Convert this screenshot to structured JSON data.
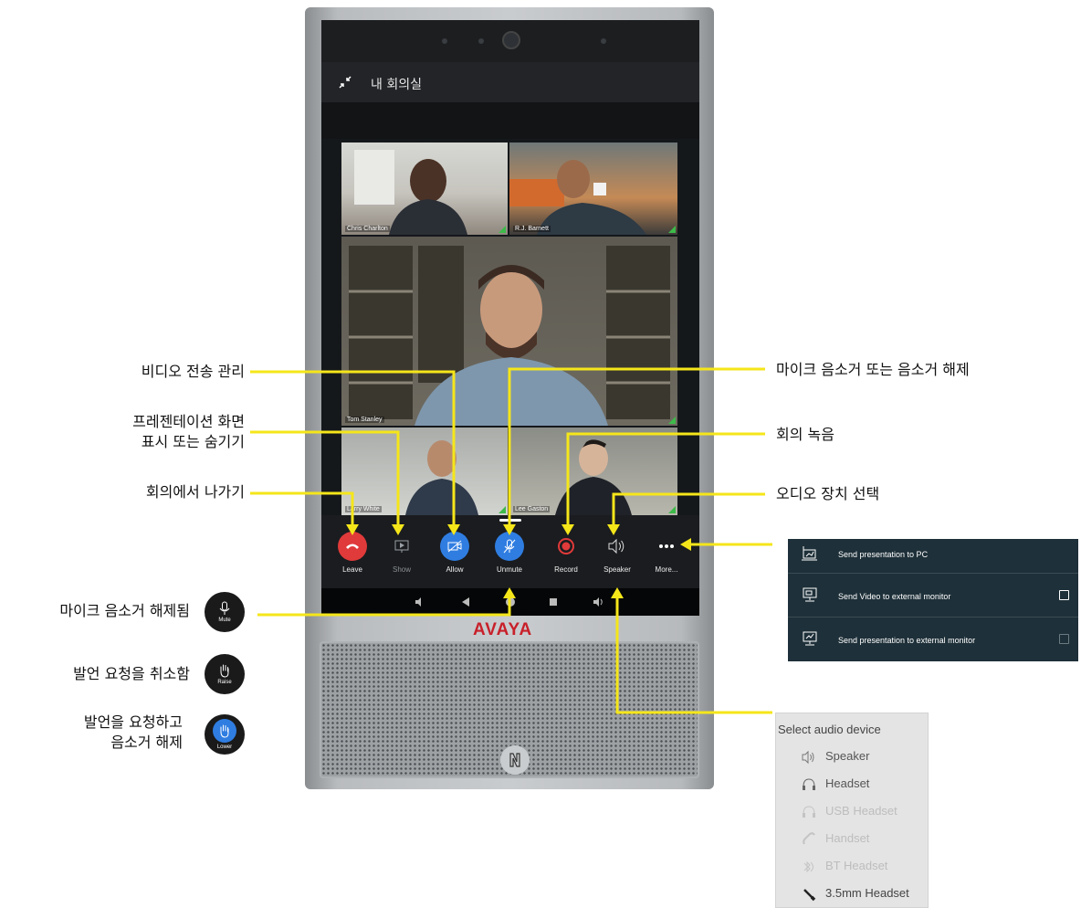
{
  "window": {
    "title": "내 회의실"
  },
  "participants": [
    {
      "name": "Chris Charlton"
    },
    {
      "name": "R.J. Barnett"
    },
    {
      "name": "Tom Stanley"
    },
    {
      "name": "Larry White"
    },
    {
      "name": "Lee Gaston"
    }
  ],
  "controls": [
    {
      "id": "leave",
      "label": "Leave",
      "color": "#e03a3a"
    },
    {
      "id": "show",
      "label": "Show"
    },
    {
      "id": "allow",
      "label": "Allow",
      "color": "#2f7de1"
    },
    {
      "id": "unmute",
      "label": "Unmute",
      "color": "#2f7de1"
    },
    {
      "id": "record",
      "label": "Record",
      "color": "#e03a3a"
    },
    {
      "id": "speaker",
      "label": "Speaker"
    },
    {
      "id": "more",
      "label": "More..."
    }
  ],
  "brand": {
    "logo": "AVAYA",
    "color": "#c8202a"
  },
  "callouts": {
    "video_tx": "비디오 전송 관리",
    "presentation_1": "프레젠테이션 화면",
    "presentation_2": "표시 또는 숨기기",
    "leave": "회의에서 나가기",
    "mic": "마이크 음소거 또는 음소거 해제",
    "record": "회의 녹음",
    "audio": "오디오 장치 선택",
    "mic_unmuted": "마이크 음소거 해제됨",
    "cancel_raise": "발언 요청을 취소함",
    "raise_unmute_1": "발언을 요청하고",
    "raise_unmute_2": "음소거 해제"
  },
  "legend_icons": [
    {
      "caption": "Mute",
      "icon": "mic-icon"
    },
    {
      "caption": "Raise",
      "icon": "hand-icon"
    },
    {
      "caption": "Lower",
      "icon": "hand-icon"
    }
  ],
  "presentation_menu": [
    {
      "label": "Send presentation to PC",
      "checkbox": false
    },
    {
      "label": "Send Video to external monitor",
      "checkbox": true
    },
    {
      "label": "Send presentation to external monitor",
      "checkbox": true
    }
  ],
  "audio_menu": {
    "title": "Select audio device",
    "items": [
      {
        "label": "Speaker",
        "enabled": true
      },
      {
        "label": "Headset",
        "enabled": true
      },
      {
        "label": "USB Headset",
        "enabled": false
      },
      {
        "label": "Handset",
        "enabled": false
      },
      {
        "label": "BT Headset",
        "enabled": false
      },
      {
        "label": "3.5mm Headset",
        "enabled": true
      }
    ]
  },
  "colors": {
    "callout_line": "#f5e61a",
    "accent_blue": "#2f7de1",
    "accent_red": "#e03a3a"
  }
}
